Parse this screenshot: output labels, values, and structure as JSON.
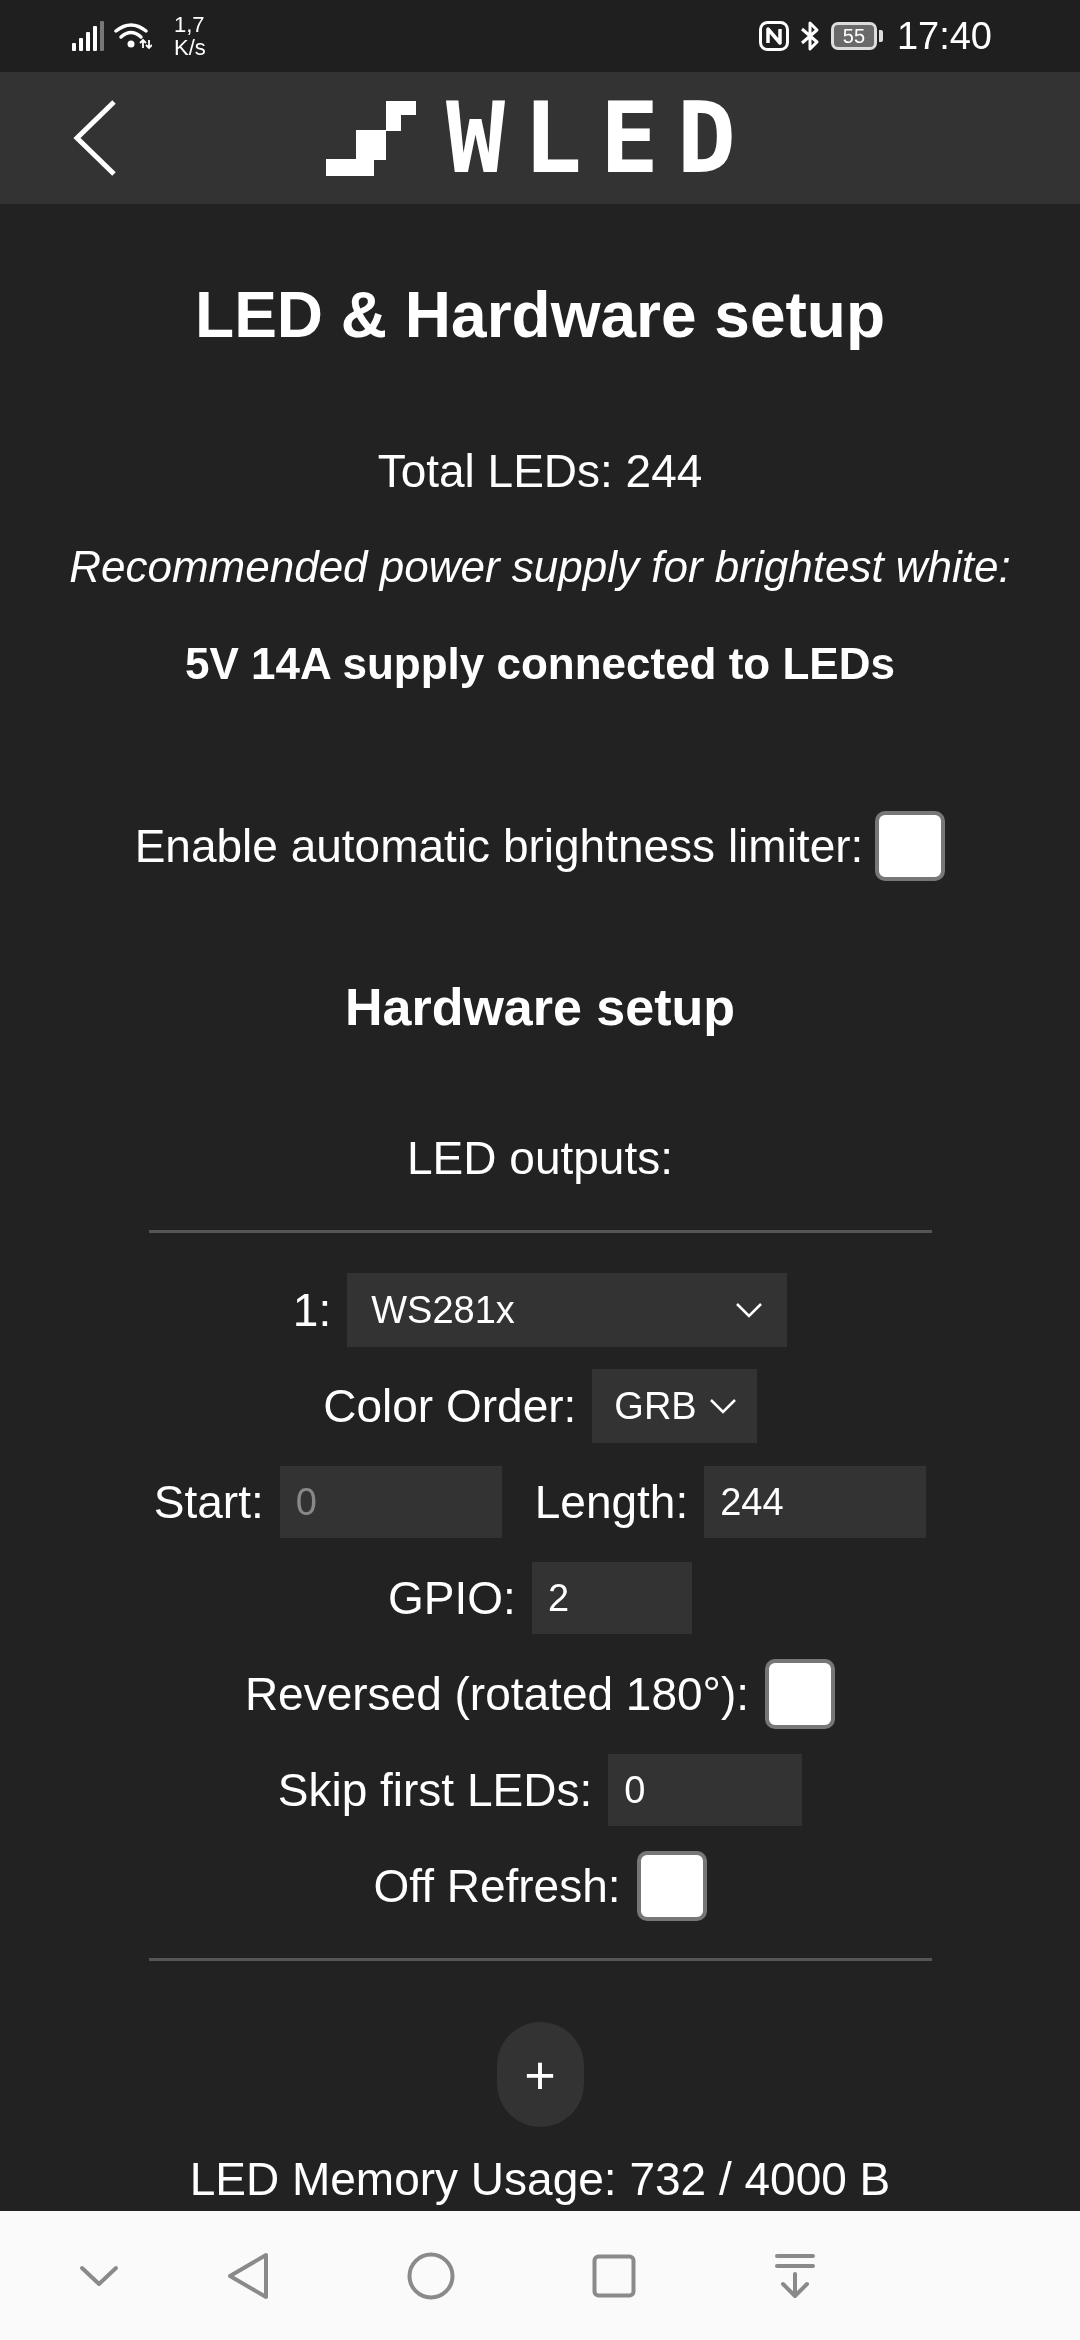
{
  "status_bar": {
    "speed_value": "1,7",
    "speed_unit": "K/s",
    "battery": "55",
    "time": "17:40"
  },
  "header": {
    "logo": "WLED"
  },
  "title": "LED & Hardware setup",
  "summary": {
    "total": "Total LEDs: 244",
    "recommendation": "Recommended power supply for brightest white:",
    "supply": "5V 14A supply connected to LEDs"
  },
  "brightness_limiter": {
    "label": "Enable automatic brightness limiter:",
    "checked": false
  },
  "hardware_heading": "Hardware setup",
  "outputs_label": "LED outputs:",
  "output_rows": [
    {
      "fields": [
        {
          "kind": "select",
          "label": "1:",
          "value": "WS281x",
          "disabled": false
        }
      ]
    },
    {
      "fields": [
        {
          "kind": "select",
          "label": "Color Order:",
          "value": "GRB",
          "disabled": false
        }
      ]
    },
    {
      "fields": [
        {
          "kind": "input",
          "label": "Start:",
          "value": "0",
          "disabled": true
        },
        {
          "kind": "input",
          "label": "Length:",
          "value": "244",
          "disabled": false
        }
      ]
    },
    {
      "fields": [
        {
          "kind": "input",
          "label": "GPIO:",
          "value": "2",
          "disabled": false
        }
      ]
    },
    {
      "fields": [
        {
          "kind": "checkbox",
          "label": "Reversed (rotated 180°):",
          "checked": false,
          "disabled": false
        }
      ]
    },
    {
      "fields": [
        {
          "kind": "input",
          "label": "Skip first LEDs:",
          "value": "0",
          "disabled": false
        }
      ]
    },
    {
      "fields": [
        {
          "kind": "checkbox",
          "label": "Off Refresh:",
          "checked": false,
          "disabled": false
        }
      ]
    }
  ],
  "add_button": "+",
  "memory_usage": "LED Memory Usage: 732 / 4000 B"
}
